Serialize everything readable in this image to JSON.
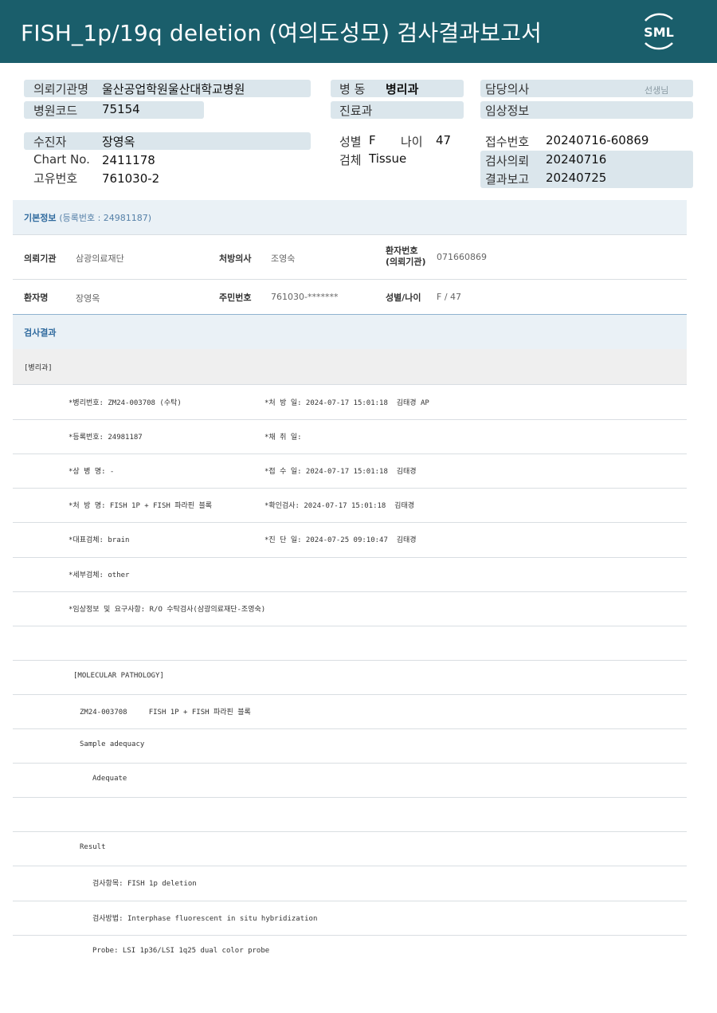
{
  "header": {
    "title": "FISH_1p/19q  deletion  (여의도성모) 검사결과보고서",
    "logo_text": "SML",
    "bg_color": "#1a5e6b"
  },
  "patient_block": {
    "institution_label": "의뢰기관명",
    "institution": "울산공업학원울산대학교병원",
    "hospital_code_label": "병원코드",
    "hospital_code": "75154",
    "ward_label": "병   동",
    "ward": "병리과",
    "dept_label": "진료과",
    "dept": "",
    "doctor_label": "담당의사",
    "doctor_suffix": "선생님",
    "clinical_label": "임상정보",
    "clinical": "",
    "examinee_label": "수진자",
    "examinee": "장영옥",
    "chart_label": "Chart No.",
    "chart_no": "2411178",
    "unique_label": "고유번호",
    "unique_no": "761030-2",
    "sex_label": "성별",
    "sex": "F",
    "age_label": "나이",
    "age": "47",
    "specimen_label": "검체",
    "specimen": "Tissue",
    "receipt_label": "접수번호",
    "receipt_no": "20240716-60869",
    "request_label": "검사의뢰",
    "request_date": "20240716",
    "report_label": "결과보고",
    "report_date": "20240725"
  },
  "basic_info": {
    "title": "기본정보",
    "note": "(등록번호 : 24981187)",
    "rows": [
      {
        "l1": "의뢰기관",
        "v1": "삼광의료재단",
        "l2": "처방의사",
        "v2": "조영숙",
        "l3": "환자번호\n(의뢰기관)",
        "v3": "071660869"
      },
      {
        "l1": "환자명",
        "v1": "장영옥",
        "l2": "주민번호",
        "v2": "761030-*******",
        "l3": "성별/나이",
        "v3": "F / 47"
      }
    ]
  },
  "result": {
    "title": "검사결과",
    "dept_tag": "[병리과]",
    "lines": [
      {
        "left": "*병리번호: ZM24-003708 (수탁)",
        "right": "*처 방 일: 2024-07-17 15:01:18  김태경 AP"
      },
      {
        "left": "*등록번호: 24981187",
        "right": "*채 취 일:"
      },
      {
        "left": "*상 병 명: -",
        "right": "*접 수 일: 2024-07-17 15:01:18  김태경"
      },
      {
        "left": "*처 방 명: FISH 1P + FISH 파라핀 블록",
        "right": "*확인검사: 2024-07-17 15:01:18  김태경"
      },
      {
        "left": "*대표검체: brain",
        "right": "*진 단 일: 2024-07-25 09:10:47  김태경"
      },
      {
        "left": "*세부검체: other",
        "right": ""
      },
      {
        "left": "*임상정보 및 요구사항: R/O 수탁검사(삼광의료재단-조영숙)",
        "right": ""
      },
      {
        "left": "",
        "right": ""
      },
      {
        "left": "[MOLECULAR PATHOLOGY]",
        "right": ""
      },
      {
        "left": "ZM24-003708     FISH 1P + FISH 파라핀 블록",
        "right": ""
      },
      {
        "left": "Sample adequacy",
        "right": ""
      },
      {
        "left": "Adequate",
        "right": ""
      },
      {
        "left": "",
        "right": ""
      },
      {
        "left": "Result",
        "right": ""
      },
      {
        "left": "검사항목: FISH 1p deletion",
        "right": ""
      },
      {
        "left": "검사방법: Interphase fluorescent in situ hybridization",
        "right": ""
      },
      {
        "left": "Probe: LSI 1p36/LSI 1q25 dual color probe",
        "right": ""
      }
    ]
  }
}
